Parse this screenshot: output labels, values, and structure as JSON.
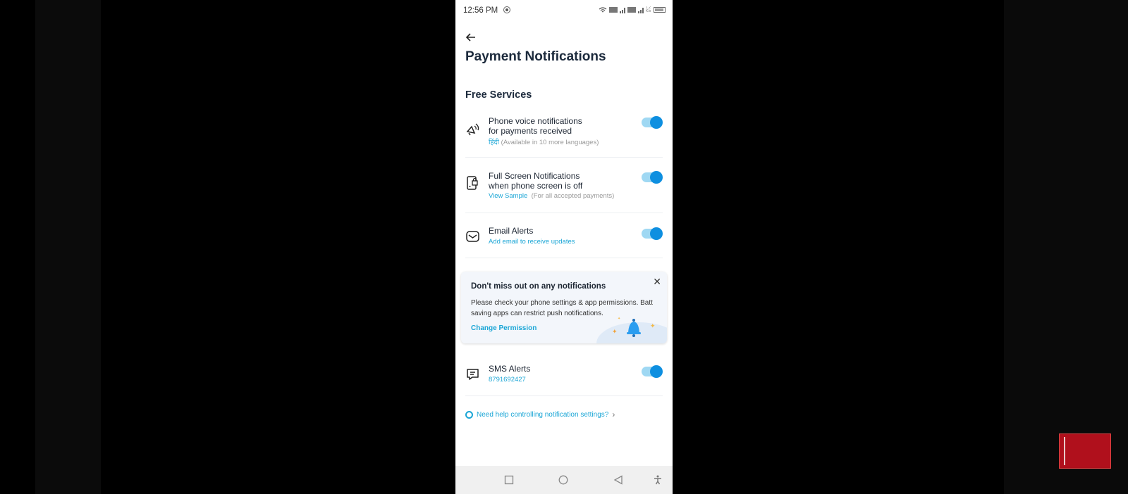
{
  "status_bar": {
    "time": "12:56 PM",
    "net_speed": "1.2 K/s"
  },
  "header": {
    "back_label": "Back",
    "title": "Payment Notifications"
  },
  "section_title": "Free Services",
  "settings": [
    {
      "icon": "speaker-voice-icon",
      "line1": "Phone voice notifications",
      "line2": "for payments received",
      "link": "हिंदी",
      "note": "(Available in 10 more languages)",
      "enabled": true
    },
    {
      "icon": "phone-lock-icon",
      "line1": "Full Screen Notifications",
      "line2": "when phone screen is off",
      "link": "View Sample",
      "note": "(For all accepted payments)",
      "enabled": true
    },
    {
      "icon": "envelope-icon",
      "line1": "Email Alerts",
      "link": "Add email to receive updates",
      "enabled": true
    },
    {
      "icon": "message-icon",
      "line1": "SMS Alerts",
      "link": "8791692427",
      "enabled": true
    }
  ],
  "banner": {
    "title": "Don't miss out on any notifications",
    "body_line1": "Please check your phone settings & app permissions. Batt",
    "body_line2": "saving apps can restrict push notifications.",
    "action": "Change Permission",
    "close_glyph": "✕"
  },
  "help_link": "Need help controlling notification settings?",
  "help_chevron": "›",
  "colors": {
    "accent": "#1ba6d6",
    "toggle_on": "#0e8fe0",
    "title": "#1c2a3c"
  }
}
